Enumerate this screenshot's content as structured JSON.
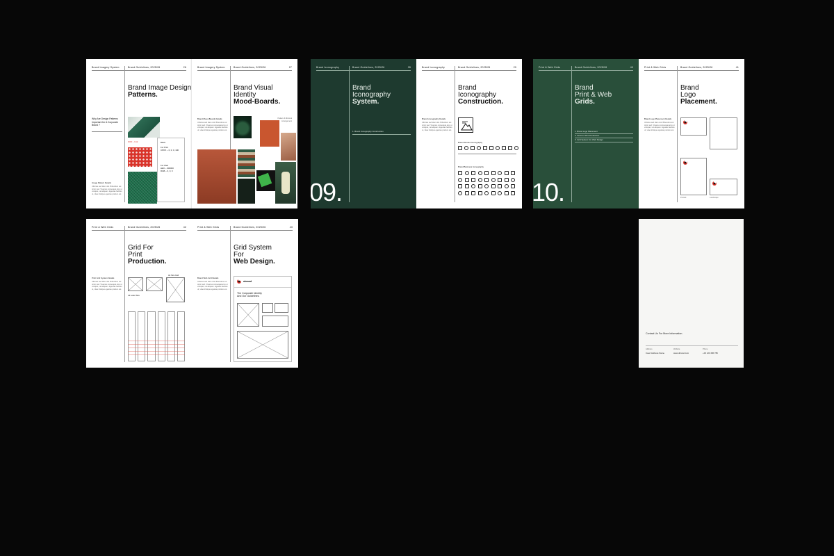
{
  "spreads": {
    "s1": {
      "left_header": "Brand Imagery System",
      "left_header2": "Brand Guidelines, 2025/26",
      "left_page_no": "26",
      "right_header": "Brand Imagery System",
      "right_header2": "Brand Guidelines, 2025/26",
      "right_page_no": "27",
      "title_light": "Brand Image Design",
      "title_bold": "Patterns.",
      "question": "Why Are Design Patterns Important for A Corporate Brand ?",
      "pattern_details_label": "Image Pattern Details",
      "body_text": "Ultricies sed diam nisl. Bibendum est tortor sed. Vivamus consequat arcu ut volutpat, vel aliquam. Egestas facilisis ut, vitae tristique egestas pretium est.",
      "swatch_black": "Black",
      "swatch_for_print": "For Print",
      "swatch_cmyk": "CMYK – 0, 0, 0, 100",
      "swatch_for_web": "For Web",
      "swatch_hex": "HEX – 000000",
      "swatch_rgb": "RGB – 0, 0, 0",
      "code_label": "FFFF – 9.12",
      "mineral": "& Mineral",
      "title2_light1": "Brand Visual",
      "title2_light2": "Identity",
      "title2_bold": "Mood-Boards.",
      "moodboard_label": "Brand Mood-Boards Details",
      "moodboard_side": "Pattern & Minimal Arrangement"
    },
    "s2": {
      "left_header": "Brand Iconography",
      "left_header2": "Brand Guidelines, 2025/26",
      "left_page_no": "28",
      "right_header": "Brand Iconography",
      "right_header2": "Brand Guidelines, 2025/26",
      "right_page_no": "29",
      "title_light1": "Brand",
      "title_light2": "Iconography",
      "title_bold": "System.",
      "toc_item": "1.   Brand Iconography Construction",
      "big_number": "09.",
      "r_title_light1": "Brand",
      "r_title_light2": "Iconography",
      "r_title_bold": "Construction.",
      "r_label": "Brand Iconography Details",
      "r_strokes": "Brand Strokes Iconography",
      "r_business": "Brand Business Iconography"
    },
    "s3": {
      "left_header": "Print & Web Grids",
      "left_header2": "Brand Guidelines, 2025/26",
      "left_page_no": "40",
      "right_header": "Print & Web Grids",
      "right_header2": "Brand Guidelines, 2025/26",
      "right_page_no": "41",
      "title_light1": "Brand",
      "title_light2": "Print & Web",
      "title_bold": "Grids.",
      "toc": [
        "1.   Brand Logo Placement",
        "2.   Grid For Print Production",
        "3.   Grid System For Web Design"
      ],
      "big_number": "10.",
      "r_title_light1": "Brand",
      "r_title_light2": "Logo",
      "r_title_bold": "Placement.",
      "r_label": "Brand Logo Placement Details",
      "cap1": "Portrait",
      "cap2": "Landscape"
    },
    "s4": {
      "left_header": "Print & Web Grids",
      "left_header2": "Brand Guidelines, 2025/26",
      "left_page_no": "42",
      "right_header": "Print & Web Grids",
      "right_header2": "Brand Guidelines, 2025/26",
      "right_page_no": "43",
      "title_light1": "Grid For",
      "title_light2": "Print",
      "title_bold": "Production.",
      "label": "Print Grid System Details",
      "a4": "A4 Size Grid",
      "a3": "A3 Letter Size",
      "r_title_light1": "Grid System",
      "r_title_light2": "For",
      "r_title_bold": "Web Design.",
      "r_label": "Brand Web Grid Details",
      "brand_name": "ubrand",
      "web_heading": "The Corporate Identity And Our Guidelines."
    },
    "back": {
      "contact": "Contact Us For More Information.",
      "col1_label": "Address",
      "col1_value": "Insert Address Name",
      "col2_label": "Website",
      "col2_value": "www.ubrand.com",
      "col3_label": "Phone",
      "col3_value": "+00 123 456 789"
    }
  }
}
